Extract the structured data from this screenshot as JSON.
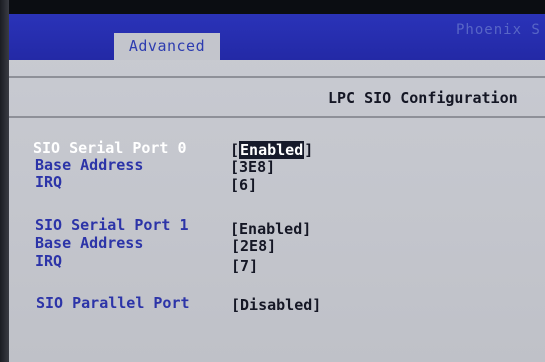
{
  "menubar": {
    "active_tab": "Advanced",
    "brand": "Phoenix S"
  },
  "page": {
    "title": "LPC SIO Configuration"
  },
  "settings": [
    {
      "label": "SIO Serial Port 0",
      "value": "Enabled",
      "selected": true
    },
    {
      "label": "Base Address",
      "value": "3E8"
    },
    {
      "label": "IRQ",
      "value": "6"
    },
    {
      "label": "SIO Serial Port 1",
      "value": "Enabled"
    },
    {
      "label": "Base Address",
      "value": "2E8"
    },
    {
      "label": "IRQ",
      "value": "7"
    },
    {
      "label": "SIO Parallel Port",
      "value": "Disabled"
    }
  ],
  "colors": {
    "menubar": "#2a33b8",
    "background": "#c4c6cd",
    "label": "#2c34a8",
    "value": "#151725",
    "highlight": "#161a2a"
  }
}
